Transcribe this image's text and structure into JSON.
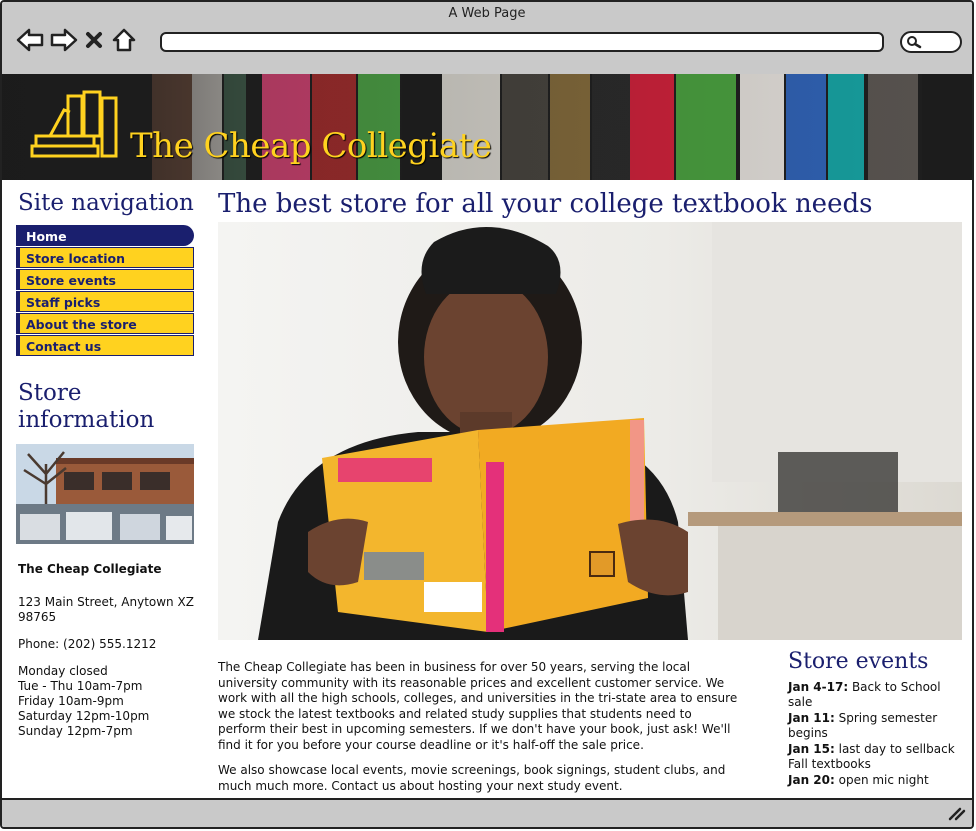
{
  "window": {
    "title": "A Web Page"
  },
  "colors": {
    "brand_navy": "#1a1f6e",
    "brand_gold": "#ffd21f",
    "chrome_gray": "#c9c9c9"
  },
  "icons": [
    "back-arrow-icon",
    "forward-arrow-icon",
    "close-x-icon",
    "home-icon",
    "search-icon",
    "resize-grip-icon"
  ],
  "banner": {
    "site_title": "The Cheap Collegiate"
  },
  "sidebar": {
    "nav_heading": "Site navigation",
    "nav_items": [
      {
        "label": "Home",
        "active": true
      },
      {
        "label": "Store location"
      },
      {
        "label": "Store events"
      },
      {
        "label": "Staff picks"
      },
      {
        "label": "About the store"
      },
      {
        "label": "Contact us"
      }
    ],
    "info_heading": "Store information",
    "store_name": "The Cheap Collegiate",
    "address": "123 Main Street, Anytown XZ 98765",
    "phone": "Phone: (202) 555.1212",
    "hours": [
      "Monday closed",
      "Tue - Thu 10am-7pm",
      "Friday 10am-9pm",
      "Saturday 12pm-10pm",
      "Sunday 12pm-7pm"
    ]
  },
  "main": {
    "headline": "The best store for all your college textbook needs",
    "paragraphs": [
      "The Cheap Collegiate has been in business for over 50 years, serving the local university community with its reasonable prices and excellent customer service. We work with all the high schools, colleges, and universities in the tri-state area to ensure we stock the latest textbooks and related study supplies that students need to perform their best in upcoming semesters. If we don't have your book, just ask! We'll find it for you before your course deadline or it's half-off the sale price.",
      "We also showcase local events, movie screenings, book signings, student clubs, and much much more. Contact us about hosting your next study event."
    ]
  },
  "events": {
    "heading": "Store events",
    "items": [
      {
        "date": "Jan 4-17:",
        "text": "Back to School sale"
      },
      {
        "date": "Jan 11:",
        "text": "Spring semester begins"
      },
      {
        "date": "Jan 15:",
        "text": "last day to sellback Fall textbooks"
      },
      {
        "date": "Jan 20:",
        "text": "open mic night"
      }
    ]
  }
}
